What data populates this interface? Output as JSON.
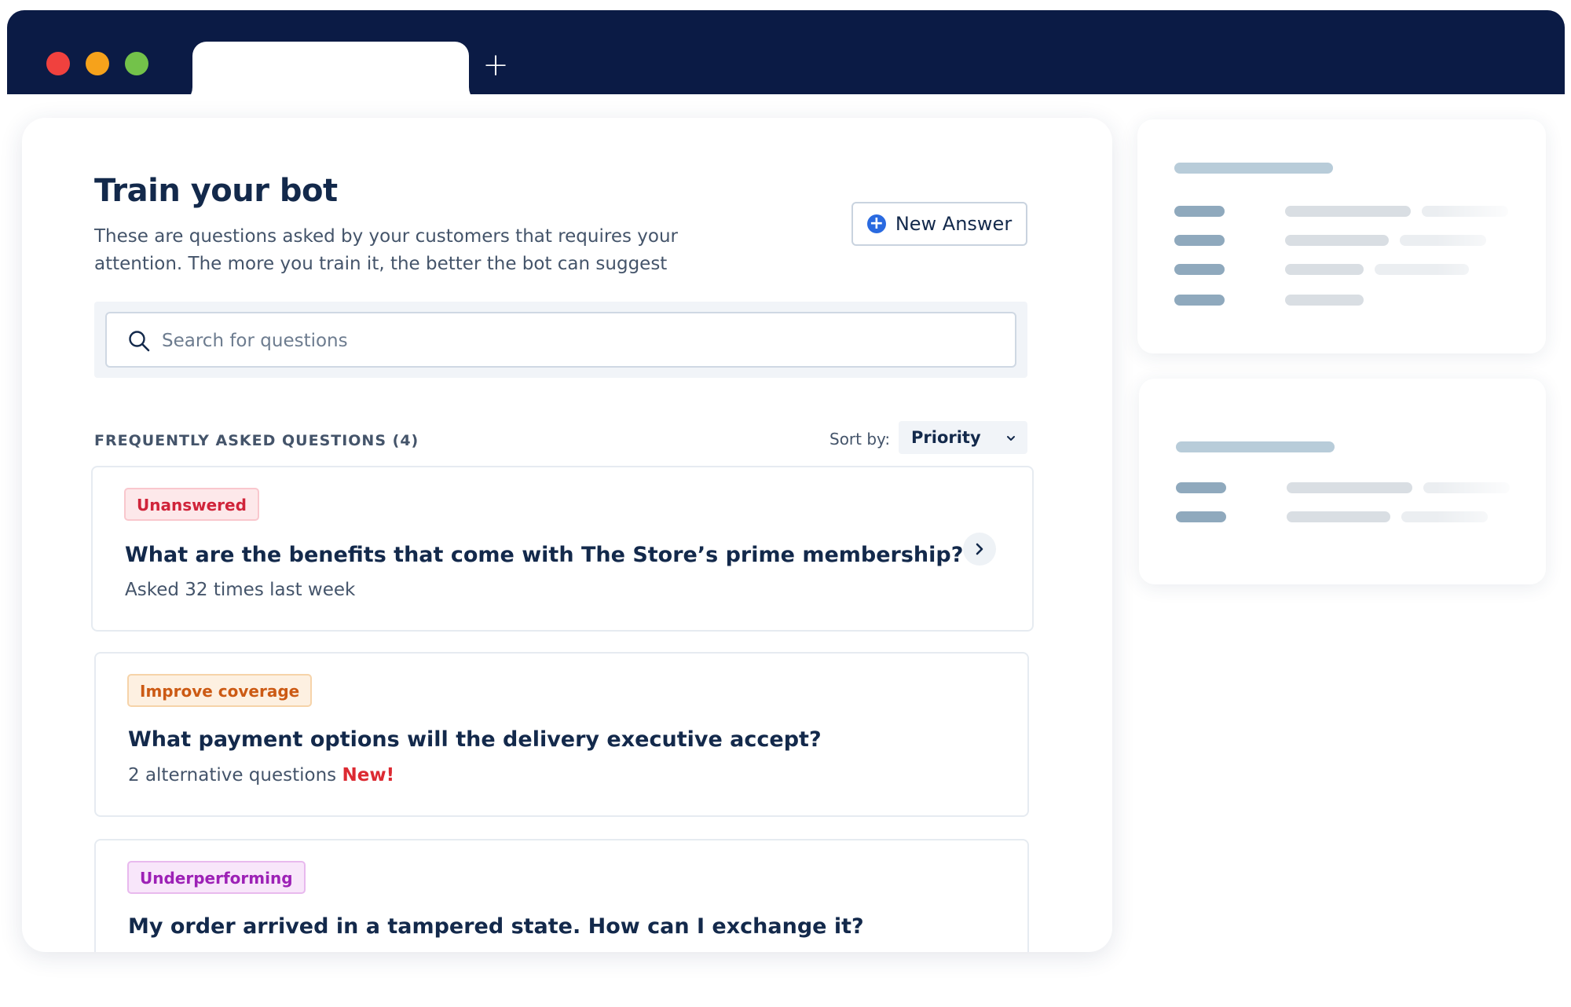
{
  "browser": {
    "new_tab_symbol": "+"
  },
  "page": {
    "title": "Train your bot",
    "description": "These are questions asked by your customers that requires your attention. The more you train it, the better the bot can suggest",
    "new_answer_label": "New Answer",
    "new_answer_icon": "plus-circle-icon"
  },
  "search": {
    "placeholder": "Search for questions",
    "value": ""
  },
  "faq": {
    "header": "FREQUENTLY ASKED QUESTIONS (4)",
    "sort_label": "Sort by:",
    "sort_value": "Priority",
    "items": [
      {
        "badge": "Unanswered",
        "title": "What are the benefits that come with The Store’s prime membership?",
        "meta": "Asked 32 times last week",
        "flag": ""
      },
      {
        "badge": "Improve coverage",
        "title": "What payment options will the delivery executive accept?",
        "meta": "2 alternative questions",
        "flag": "New!"
      },
      {
        "badge": "Underperforming",
        "title": "My order arrived in a tampered state. How can I exchange it?",
        "meta": "",
        "flag": ""
      }
    ]
  },
  "colors": {
    "chrome_bg": "#0b1b45",
    "title_text": "#13294b",
    "accent_blue": "#2a6ae0",
    "badge_unanswered": "#d0243a",
    "badge_improve": "#cc5a14",
    "badge_underperforming": "#9d21b6",
    "new_flag": "#dc2a32"
  }
}
